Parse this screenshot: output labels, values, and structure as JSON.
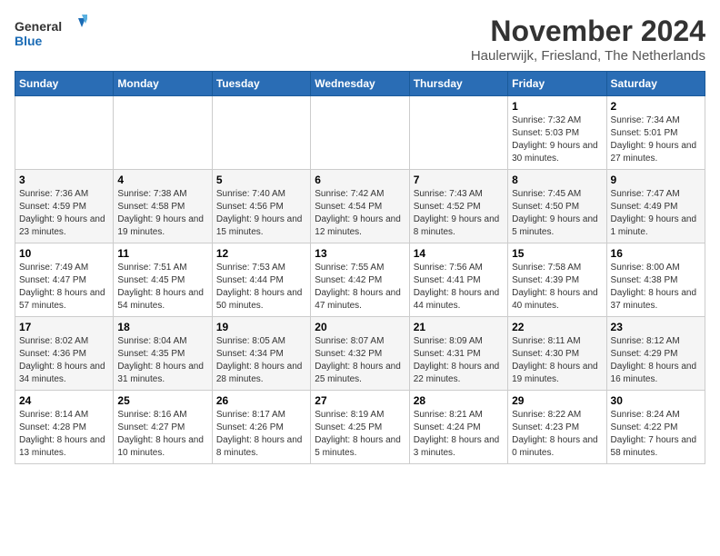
{
  "header": {
    "logo_text_general": "General",
    "logo_text_blue": "Blue",
    "month_title": "November 2024",
    "location": "Haulerwijk, Friesland, The Netherlands"
  },
  "days_of_week": [
    "Sunday",
    "Monday",
    "Tuesday",
    "Wednesday",
    "Thursday",
    "Friday",
    "Saturday"
  ],
  "weeks": [
    [
      {
        "day": "",
        "info": ""
      },
      {
        "day": "",
        "info": ""
      },
      {
        "day": "",
        "info": ""
      },
      {
        "day": "",
        "info": ""
      },
      {
        "day": "",
        "info": ""
      },
      {
        "day": "1",
        "info": "Sunrise: 7:32 AM\nSunset: 5:03 PM\nDaylight: 9 hours and 30 minutes."
      },
      {
        "day": "2",
        "info": "Sunrise: 7:34 AM\nSunset: 5:01 PM\nDaylight: 9 hours and 27 minutes."
      }
    ],
    [
      {
        "day": "3",
        "info": "Sunrise: 7:36 AM\nSunset: 4:59 PM\nDaylight: 9 hours and 23 minutes."
      },
      {
        "day": "4",
        "info": "Sunrise: 7:38 AM\nSunset: 4:58 PM\nDaylight: 9 hours and 19 minutes."
      },
      {
        "day": "5",
        "info": "Sunrise: 7:40 AM\nSunset: 4:56 PM\nDaylight: 9 hours and 15 minutes."
      },
      {
        "day": "6",
        "info": "Sunrise: 7:42 AM\nSunset: 4:54 PM\nDaylight: 9 hours and 12 minutes."
      },
      {
        "day": "7",
        "info": "Sunrise: 7:43 AM\nSunset: 4:52 PM\nDaylight: 9 hours and 8 minutes."
      },
      {
        "day": "8",
        "info": "Sunrise: 7:45 AM\nSunset: 4:50 PM\nDaylight: 9 hours and 5 minutes."
      },
      {
        "day": "9",
        "info": "Sunrise: 7:47 AM\nSunset: 4:49 PM\nDaylight: 9 hours and 1 minute."
      }
    ],
    [
      {
        "day": "10",
        "info": "Sunrise: 7:49 AM\nSunset: 4:47 PM\nDaylight: 8 hours and 57 minutes."
      },
      {
        "day": "11",
        "info": "Sunrise: 7:51 AM\nSunset: 4:45 PM\nDaylight: 8 hours and 54 minutes."
      },
      {
        "day": "12",
        "info": "Sunrise: 7:53 AM\nSunset: 4:44 PM\nDaylight: 8 hours and 50 minutes."
      },
      {
        "day": "13",
        "info": "Sunrise: 7:55 AM\nSunset: 4:42 PM\nDaylight: 8 hours and 47 minutes."
      },
      {
        "day": "14",
        "info": "Sunrise: 7:56 AM\nSunset: 4:41 PM\nDaylight: 8 hours and 44 minutes."
      },
      {
        "day": "15",
        "info": "Sunrise: 7:58 AM\nSunset: 4:39 PM\nDaylight: 8 hours and 40 minutes."
      },
      {
        "day": "16",
        "info": "Sunrise: 8:00 AM\nSunset: 4:38 PM\nDaylight: 8 hours and 37 minutes."
      }
    ],
    [
      {
        "day": "17",
        "info": "Sunrise: 8:02 AM\nSunset: 4:36 PM\nDaylight: 8 hours and 34 minutes."
      },
      {
        "day": "18",
        "info": "Sunrise: 8:04 AM\nSunset: 4:35 PM\nDaylight: 8 hours and 31 minutes."
      },
      {
        "day": "19",
        "info": "Sunrise: 8:05 AM\nSunset: 4:34 PM\nDaylight: 8 hours and 28 minutes."
      },
      {
        "day": "20",
        "info": "Sunrise: 8:07 AM\nSunset: 4:32 PM\nDaylight: 8 hours and 25 minutes."
      },
      {
        "day": "21",
        "info": "Sunrise: 8:09 AM\nSunset: 4:31 PM\nDaylight: 8 hours and 22 minutes."
      },
      {
        "day": "22",
        "info": "Sunrise: 8:11 AM\nSunset: 4:30 PM\nDaylight: 8 hours and 19 minutes."
      },
      {
        "day": "23",
        "info": "Sunrise: 8:12 AM\nSunset: 4:29 PM\nDaylight: 8 hours and 16 minutes."
      }
    ],
    [
      {
        "day": "24",
        "info": "Sunrise: 8:14 AM\nSunset: 4:28 PM\nDaylight: 8 hours and 13 minutes."
      },
      {
        "day": "25",
        "info": "Sunrise: 8:16 AM\nSunset: 4:27 PM\nDaylight: 8 hours and 10 minutes."
      },
      {
        "day": "26",
        "info": "Sunrise: 8:17 AM\nSunset: 4:26 PM\nDaylight: 8 hours and 8 minutes."
      },
      {
        "day": "27",
        "info": "Sunrise: 8:19 AM\nSunset: 4:25 PM\nDaylight: 8 hours and 5 minutes."
      },
      {
        "day": "28",
        "info": "Sunrise: 8:21 AM\nSunset: 4:24 PM\nDaylight: 8 hours and 3 minutes."
      },
      {
        "day": "29",
        "info": "Sunrise: 8:22 AM\nSunset: 4:23 PM\nDaylight: 8 hours and 0 minutes."
      },
      {
        "day": "30",
        "info": "Sunrise: 8:24 AM\nSunset: 4:22 PM\nDaylight: 7 hours and 58 minutes."
      }
    ]
  ]
}
